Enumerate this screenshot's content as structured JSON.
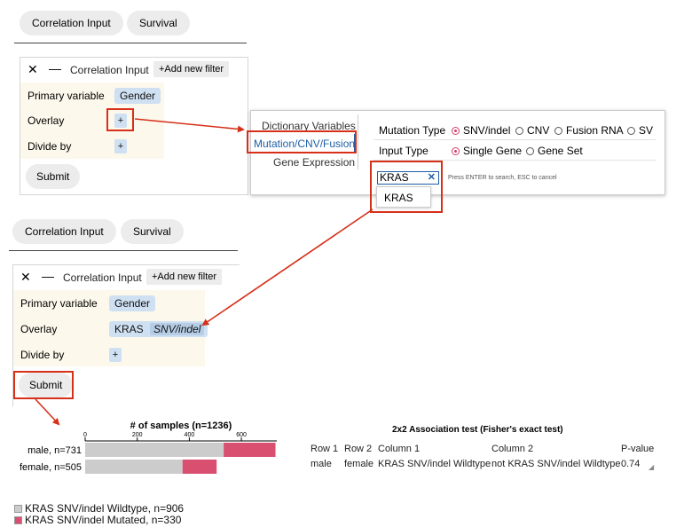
{
  "top": {
    "tabs": [
      "Correlation Input",
      "Survival"
    ]
  },
  "panel1": {
    "header": "Correlation Input",
    "add_filter": "+Add new filter",
    "rows": {
      "primary_label": "Primary variable",
      "primary_value": "Gender",
      "overlay_label": "Overlay",
      "overlay_plus": "+",
      "divide_label": "Divide by",
      "divide_plus": "+"
    },
    "submit": "Submit"
  },
  "popup": {
    "menu": [
      "Dictionary Variables",
      "Mutation/CNV/Fusion",
      "Gene Expression"
    ],
    "mutation_type_label": "Mutation Type",
    "mutation_options": [
      "SNV/indel",
      "CNV",
      "Fusion RNA",
      "SV"
    ],
    "mutation_selected": "SNV/indel",
    "input_type_label": "Input Type",
    "input_options": [
      "Single Gene",
      "Gene Set"
    ],
    "input_selected": "Single Gene",
    "search_value": "KRAS",
    "search_hint": "Press ENTER to search, ESC to cancel",
    "suggestion": "KRAS"
  },
  "second": {
    "tabs": [
      "Correlation Input",
      "Survival"
    ]
  },
  "panel2": {
    "header": "Correlation Input",
    "add_filter": "+Add new filter",
    "rows": {
      "primary_label": "Primary variable",
      "primary_value": "Gender",
      "overlay_label": "Overlay",
      "overlay_gene": "KRAS",
      "overlay_type": "SNV/indel",
      "divide_label": "Divide by",
      "divide_plus": "+"
    },
    "submit": "Submit"
  },
  "colors": {
    "wildtype": "#cccccc",
    "mutated": "#d94f6f",
    "arrow": "#d6301a",
    "chip": "#cfe0f2"
  },
  "chart_data": {
    "type": "bar",
    "title": "# of samples (n=1236)",
    "xlim": [
      0,
      736
    ],
    "ticks": [
      0,
      200,
      400,
      600
    ],
    "categories": [
      "male, n=731",
      "female, n=505"
    ],
    "series": [
      {
        "name": "KRAS SNV/indel Wildtype, n=906",
        "values": [
          532,
          374
        ]
      },
      {
        "name": "KRAS SNV/indel Mutated, n=330",
        "values": [
          199,
          131
        ]
      }
    ],
    "legend_position": "bottom-left"
  },
  "assoc": {
    "title": "2x2 Association test (Fisher's exact test)",
    "columns": [
      "Row 1",
      "Row 2",
      "Column 1",
      "Column 2",
      "P-value"
    ],
    "row": [
      "male",
      "female",
      "KRAS SNV/indel Wildtype",
      "not KRAS SNV/indel Wildtype",
      "0.74"
    ]
  }
}
